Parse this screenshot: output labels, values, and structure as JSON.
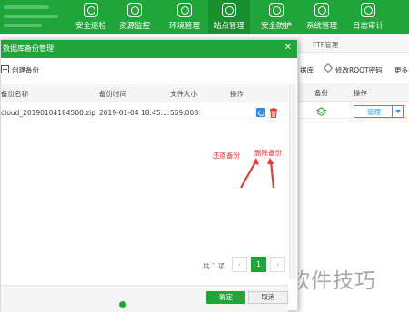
{
  "colors": {
    "brand": "#20a53a",
    "accent": "#1e9fff",
    "annotation": "#e53935"
  },
  "nav": {
    "items": [
      {
        "label": "安全巡检",
        "icon": "shield-scan-icon"
      },
      {
        "label": "资源监控",
        "icon": "monitor-icon"
      },
      {
        "label": "环境管理",
        "icon": "environment-icon"
      },
      {
        "label": "站点管理",
        "icon": "sites-icon",
        "active": true
      },
      {
        "label": "安全防护",
        "icon": "protect-icon"
      },
      {
        "label": "系统管理",
        "icon": "system-icon"
      },
      {
        "label": "日志审计",
        "icon": "log-icon"
      }
    ]
  },
  "background": {
    "ftp_tab": "FTP管理",
    "toolbar_partial_1": "据库",
    "toolbar_change_root": "修改ROOT密码",
    "toolbar_more": "更多",
    "col_backup": "备份",
    "col_action": "操作",
    "select_value": "管理"
  },
  "modal": {
    "title": "数据库备份管理",
    "create_button": "创建备份",
    "columns": {
      "name": "备份名称",
      "time": "备份时间",
      "size": "文件大小",
      "action": "操作"
    },
    "rows": [
      {
        "name": "cloud_20190104184500.zip",
        "time": "2019-01-04 18:45:...",
        "size": "569.00B"
      }
    ],
    "annotations": {
      "restore": "还原备份",
      "delete": "删除备份"
    },
    "pager": {
      "total": "共 1 项",
      "current": "1",
      "prev": "‹",
      "next": "›"
    },
    "confirm_button": "确定",
    "cancel_button": "取消"
  },
  "watermark": "软件技巧"
}
